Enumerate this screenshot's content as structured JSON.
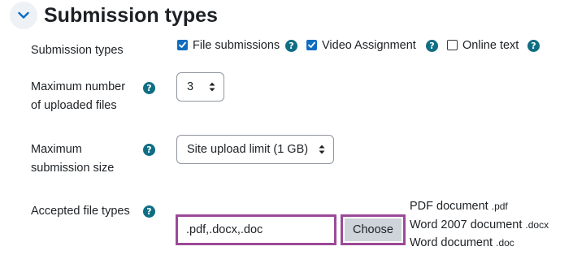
{
  "section": {
    "title": "Submission types"
  },
  "submission_types": {
    "label": "Submission types",
    "options": [
      {
        "label": "File submissions",
        "checked": true
      },
      {
        "label": "Video Assignment",
        "checked": true
      },
      {
        "label": "Online text",
        "checked": false
      }
    ]
  },
  "max_files": {
    "label_line1": "Maximum number",
    "label_line2": "of uploaded files",
    "value": "3"
  },
  "max_size": {
    "label_line1": "Maximum",
    "label_line2": "submission size",
    "value": "Site upload limit (1 GB)"
  },
  "accepted_types": {
    "label": "Accepted file types",
    "value": ".pdf,.docx,.doc",
    "choose_label": "Choose",
    "types": [
      {
        "name": "PDF document",
        "ext": ".pdf"
      },
      {
        "name": "Word 2007 document",
        "ext": ".docx"
      },
      {
        "name": "Word document",
        "ext": ".doc"
      }
    ]
  },
  "colors": {
    "help_icon": "#0f6e84",
    "checkbox_checked": "#0f6cbf",
    "highlight_outline": "#9b4a97",
    "choose_button_bg": "#ced4da"
  },
  "icons": {
    "help": "?"
  }
}
